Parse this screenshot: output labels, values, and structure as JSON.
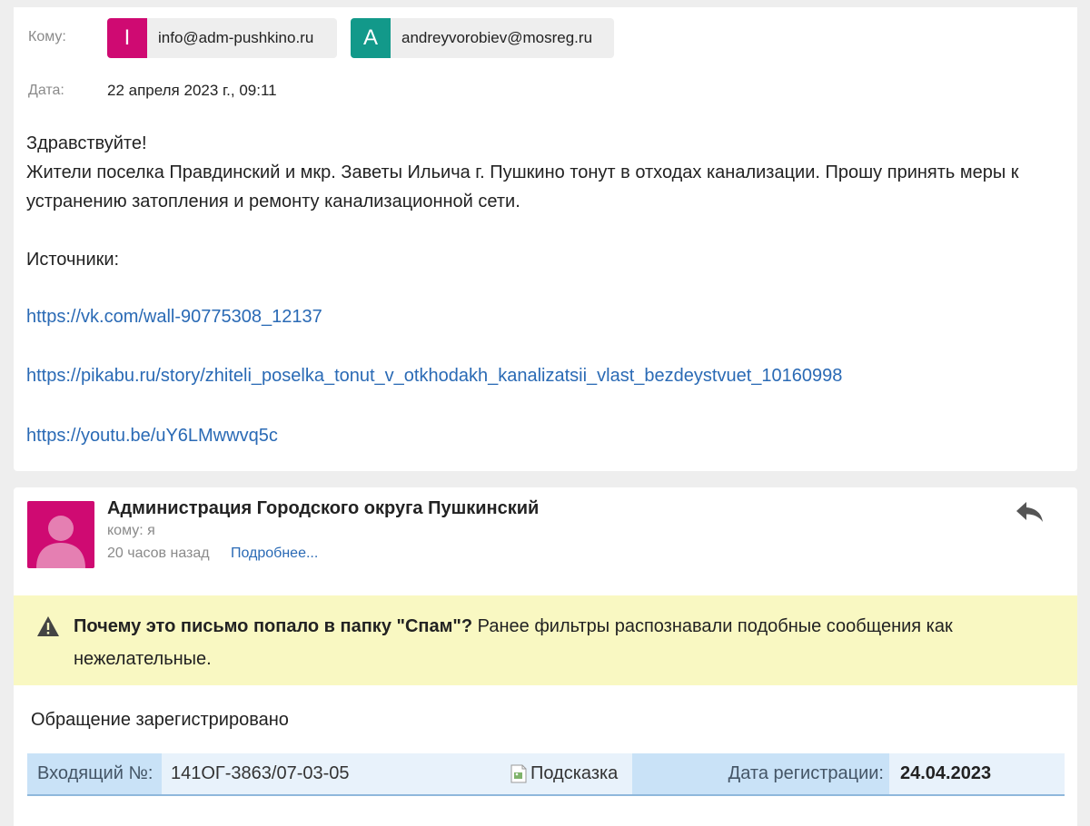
{
  "header": {
    "to_label": "Кому:",
    "date_label": "Дата:",
    "date_value": "22 апреля 2023 г., 09:11",
    "recipients": [
      {
        "initial": "I",
        "email": "info@adm-pushkino.ru",
        "color": "#cf0a72"
      },
      {
        "initial": "A",
        "email": "andreyvorobiev@mosreg.ru",
        "color": "#12998a"
      }
    ]
  },
  "message": {
    "greeting": "Здравствуйте!",
    "body": "Жители поселка Правдинский и мкр. Заветы Ильича г. Пушкино тонут в отходах канализации. Прошу принять меры к устранению затопления и ремонту канализационной сети.",
    "sources_label": "Источники:",
    "links": [
      "https://vk.com/wall-90775308_12137",
      "https://pikabu.ru/story/zhiteli_poselka_tonut_v_otkhodakh_kanalizatsii_vlast_bezdeystvuet_10160998",
      "https://youtu.be/uY6LMwwvq5c"
    ]
  },
  "reply": {
    "sender_name": "Администрация Городского округа Пушкинский",
    "to_line": "кому: я",
    "time_ago": "20 часов назад",
    "more_link": "Подробнее...",
    "avatar_color": "#cf0a72",
    "spam_question": "Почему это письмо попало в папку \"Спам\"?",
    "spam_explanation": " Ранее фильтры распознавали подобные сообщения как нежелательные.",
    "registered_text": "Обращение зарегистрировано",
    "table": {
      "incoming_label": "Входящий №:",
      "incoming_value": "141ОГ-3863/07-03-05",
      "hint_alt": "Подсказка",
      "reg_date_label": "Дата регистрации:",
      "reg_date_value": "24.04.2023"
    }
  },
  "colors": {
    "link": "#2a6ab5",
    "spam_banner": "#f9f8c2",
    "table_label_bg": "#c9e2f7",
    "table_value_bg": "#e8f2fb"
  }
}
